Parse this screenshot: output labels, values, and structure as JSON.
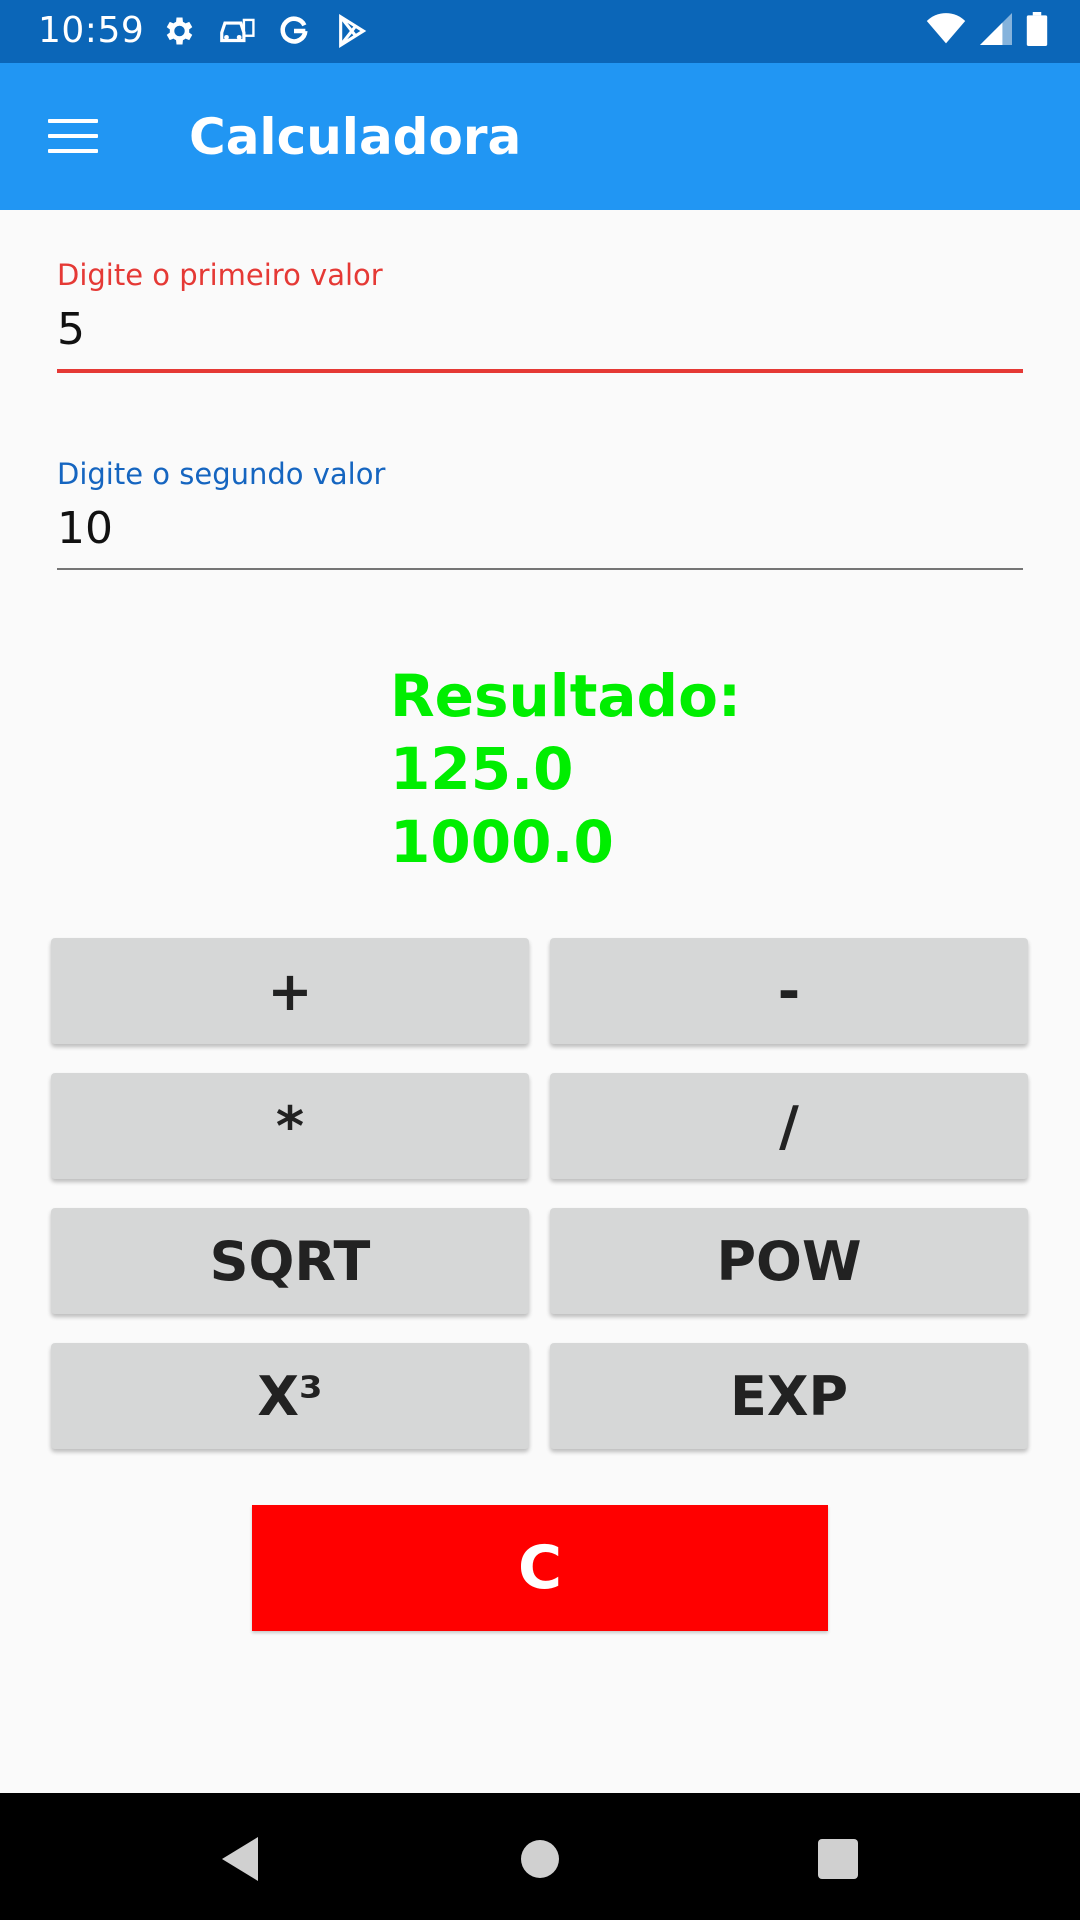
{
  "status_bar": {
    "time": "10:59",
    "left_icons": [
      "settings-icon",
      "car-icon",
      "google-icon",
      "play-store-icon"
    ],
    "right_icons": [
      "wifi-icon",
      "signal-icon",
      "battery-icon"
    ]
  },
  "app_bar": {
    "title": "Calculadora",
    "menu_icon": "menu-icon",
    "color": "#2196f3"
  },
  "form": {
    "first_value": {
      "label": "Digite o primeiro valor",
      "value": "5",
      "accent": "#e53935"
    },
    "second_value": {
      "label": "Digite o segundo valor",
      "value": "10",
      "accent": "#1565c0"
    }
  },
  "result": {
    "label": "Resultado:",
    "line1": "125.0",
    "line2": "1000.0",
    "color": "#00ee00"
  },
  "buttons": {
    "add": "+",
    "subtract": "-",
    "multiply": "*",
    "divide": "/",
    "sqrt": "SQRT",
    "pow": "POW",
    "cube": "X³",
    "exp": "EXP",
    "clear": "C"
  },
  "nav_bar": {
    "icons": [
      "back-icon",
      "home-icon",
      "recent-apps-icon"
    ]
  }
}
